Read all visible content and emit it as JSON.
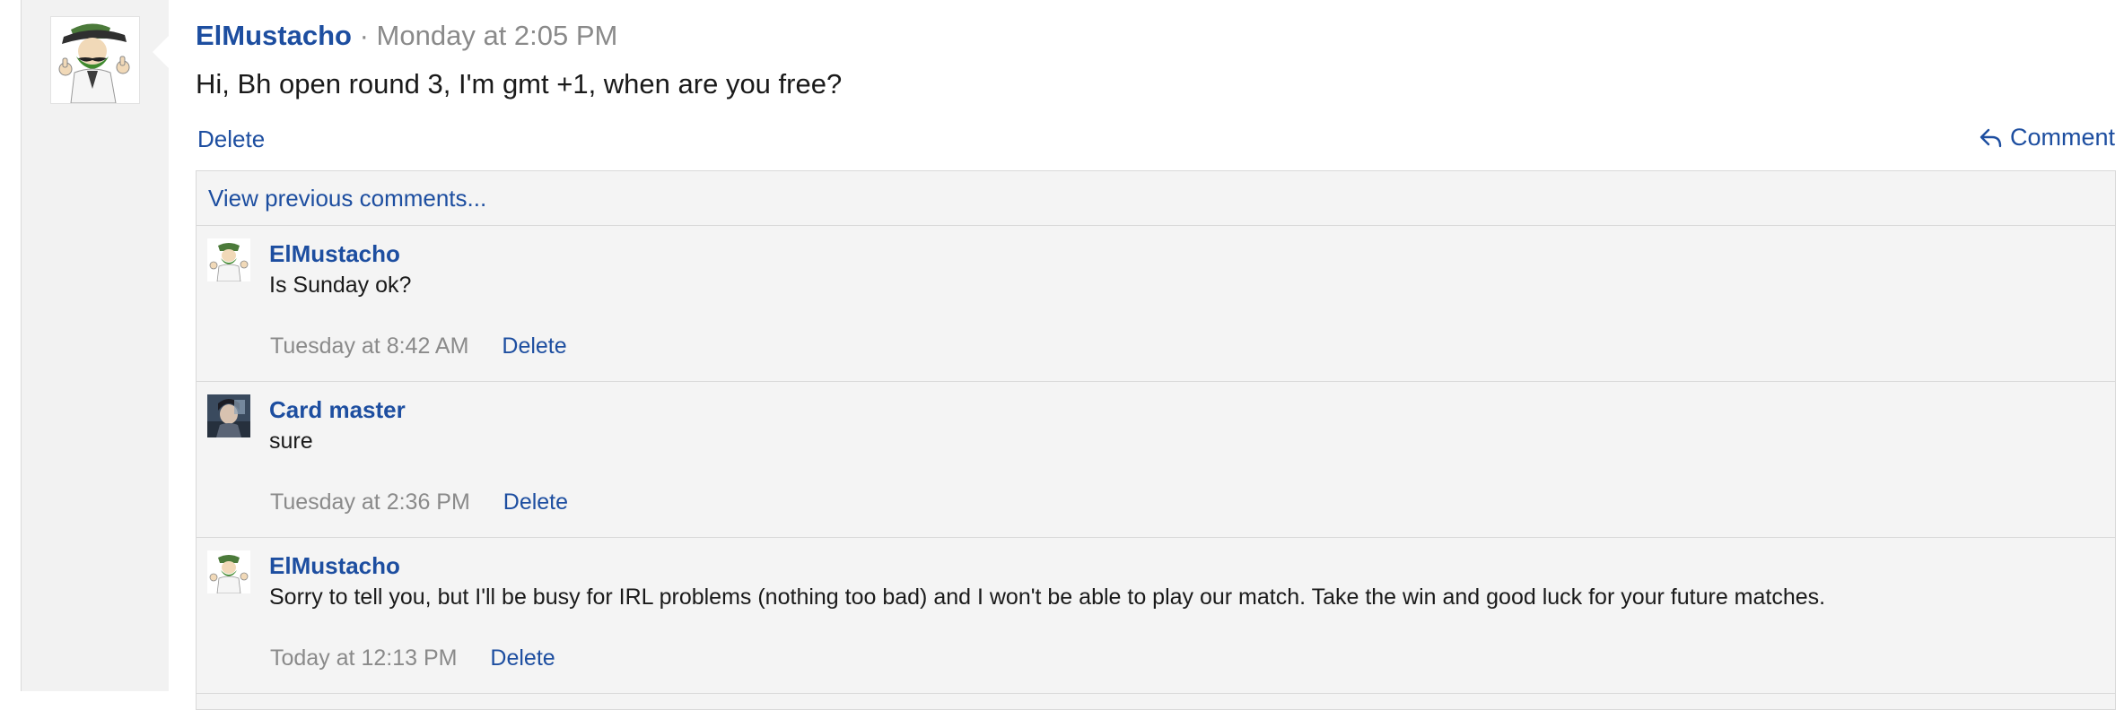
{
  "post": {
    "author": "ElMustacho",
    "separator": "·",
    "time": "Monday at 2:05 PM",
    "text": "Hi, Bh open round 3, I'm gmt +1, when are you free?",
    "delete_label": "Delete",
    "comment_label": "Comment"
  },
  "comments_section": {
    "view_previous_label": "View previous comments...",
    "items": [
      {
        "author": "ElMustacho",
        "text": "Is Sunday ok?",
        "time": "Tuesday at 8:42 AM",
        "delete_label": "Delete"
      },
      {
        "author": "Card master",
        "text": "sure",
        "time": "Tuesday at 2:36 PM",
        "delete_label": "Delete"
      },
      {
        "author": "ElMustacho",
        "text": "Sorry to tell you, but I'll be busy for IRL problems (nothing too bad) and I won't be able to play our match. Take the win and good luck for your future matches.",
        "time": "Today at 12:13 PM",
        "delete_label": "Delete"
      }
    ]
  },
  "colors": {
    "link": "#1d4ea0",
    "muted": "#8a8a8a",
    "comment_bg": "#f4f4f4",
    "gutter_bg": "#f2f2f2"
  },
  "icons": [
    "reply-arrow-icon",
    "avatar-mustache-character",
    "avatar-card-master"
  ]
}
